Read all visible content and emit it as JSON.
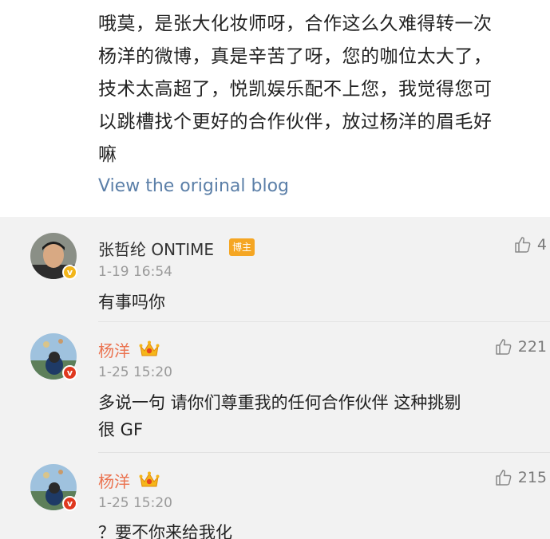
{
  "post": {
    "lines": [
      "哦莫，是张大化妆师呀，合作这么久难得转一次",
      "杨洋的微博，真是辛苦了呀，您的咖位太大了，",
      "技术太高超了，悦凯娱乐配不上您，我觉得您可",
      "以跳槽找个更好的合作伙伴，放过杨洋的眉毛好",
      "嘛"
    ],
    "view_original": "View the original blog"
  },
  "comments": [
    {
      "name": "张哲纶 ONTIME",
      "badge": "博主",
      "time": "1-19 16:54",
      "text": "有事吗你",
      "likes": "4",
      "verified": "gold"
    },
    {
      "name": "杨洋",
      "time": "1-25 15:20",
      "text_lines": [
        "多说一句 请你们尊重我的任何合作伙伴 这种挑剔",
        "很 GF"
      ],
      "likes": "221",
      "verified": "red"
    },
    {
      "name": "杨洋",
      "time": "1-25 15:20",
      "text": "？要不你来给我化",
      "likes": "215",
      "verified": "red"
    }
  ],
  "icons": {
    "like": "thumbs-up-icon",
    "crown": "crown-icon",
    "verified": "verified-badge-icon"
  },
  "colors": {
    "link": "#5b7fa8",
    "vip_name": "#eb7350",
    "author_badge": "#f5a623",
    "comment_bg": "#f2f2f2"
  }
}
